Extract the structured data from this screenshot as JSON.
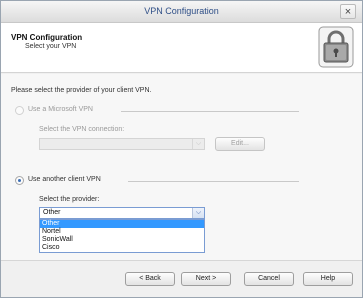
{
  "window": {
    "title": "VPN Configuration",
    "close_glyph": "×"
  },
  "header": {
    "title": "VPN Configuration",
    "subtitle": "Select your VPN",
    "icon": "vpn-lock-icon"
  },
  "content": {
    "prompt": "Please select the provider of your client VPN.",
    "microsoft": {
      "label": "Use a Microsoft VPN",
      "connection_label": "Select the VPN connection:",
      "connection_value": "",
      "edit_button": "Edit..."
    },
    "other": {
      "label": "Use another client VPN",
      "provider_label": "Select the provider:",
      "provider_value": "Other",
      "options": [
        "Other",
        "Nortel",
        "SonicWall",
        "Cisco"
      ]
    }
  },
  "footer": {
    "back": "< Back",
    "next": "Next >",
    "cancel": "Cancel",
    "help": "Help"
  }
}
